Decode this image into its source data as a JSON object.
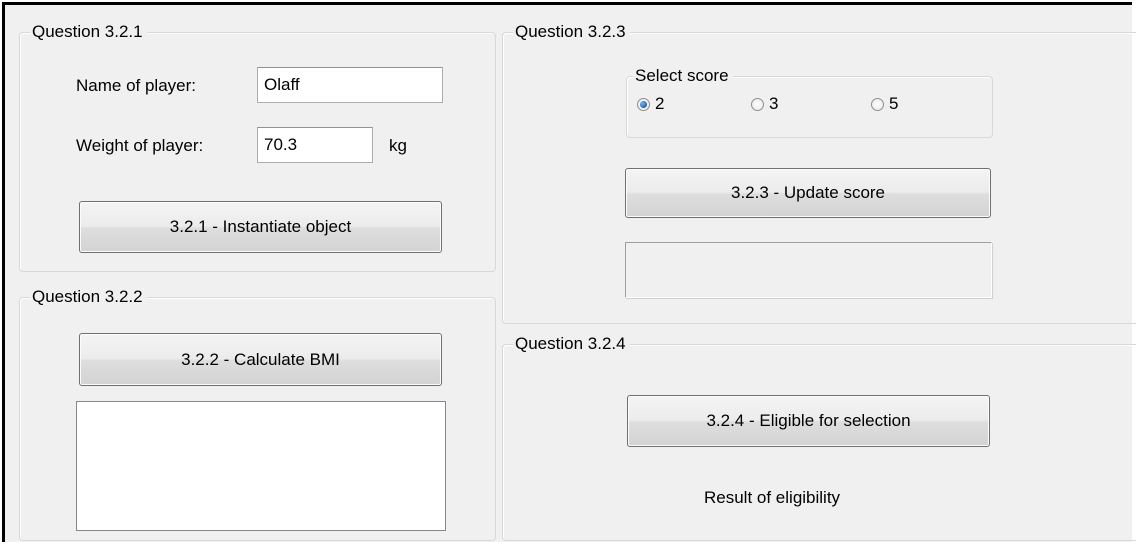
{
  "q321": {
    "title": "Question 3.2.1",
    "name_label": "Name of player:",
    "name_value": "Olaff",
    "weight_label": "Weight of player:",
    "weight_value": "70.3",
    "weight_unit": "kg",
    "button_label": "3.2.1 - Instantiate object"
  },
  "q322": {
    "title": "Question 3.2.2",
    "button_label": "3.2.2 - Calculate BMI",
    "output": ""
  },
  "q323": {
    "title": "Question 3.2.3",
    "score_group_title": "Select score",
    "options": [
      "2",
      "3",
      "5"
    ],
    "selected": "2",
    "button_label": "3.2.3 - Update score",
    "output": ""
  },
  "q324": {
    "title": "Question 3.2.4",
    "button_label": "3.2.4 - Eligible for selection",
    "result_label": "Result of eligibility"
  },
  "colors": {
    "form_background": "#f0f0f0",
    "radio_selected": "#1e5fb4"
  }
}
